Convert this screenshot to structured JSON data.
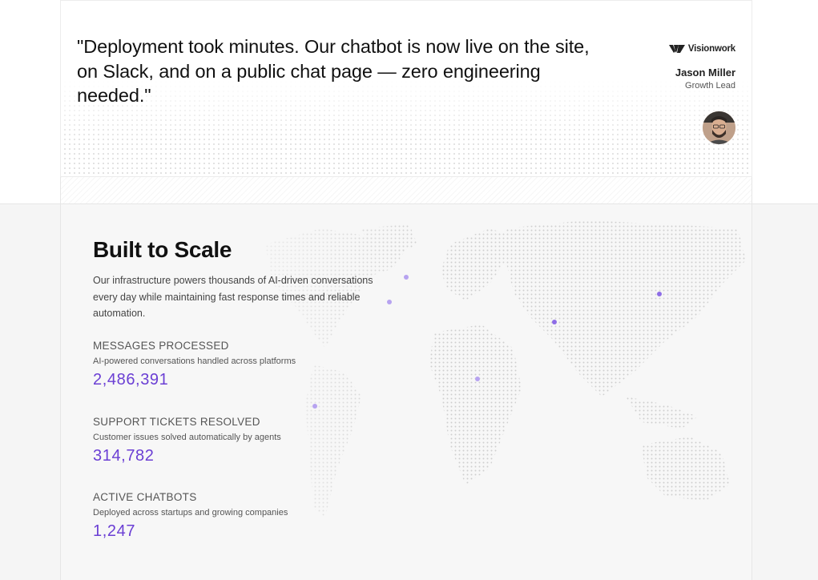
{
  "testimonial": {
    "quote": "\"Deployment took minutes. Our chatbot is now live on the site, on Slack, and on a public chat page — zero engineering needed.\"",
    "company": "Visionwork",
    "author_name": "Jason Miller",
    "author_role": "Growth Lead"
  },
  "stats_section": {
    "title": "Built to Scale",
    "description": "Our infrastructure powers thousands of AI-driven conversations every day while maintaining fast response times and reliable automation.",
    "accent_color": "#6b3fd4",
    "stats": [
      {
        "label": "MESSAGES PROCESSED",
        "sublabel": "AI-powered conversations handled across platforms",
        "value": "2,486,391"
      },
      {
        "label": "SUPPORT TICKETS RESOLVED",
        "sublabel": "Customer issues solved automatically by agents",
        "value": "314,782"
      },
      {
        "label": "ACTIVE CHATBOTS",
        "sublabel": "Deployed across startups and growing companies",
        "value": "1,247"
      }
    ]
  },
  "icons": {
    "company_logo": "visionwork-logo-icon",
    "map": "world-map-dots-icon",
    "pins": "location-pin-icon"
  }
}
